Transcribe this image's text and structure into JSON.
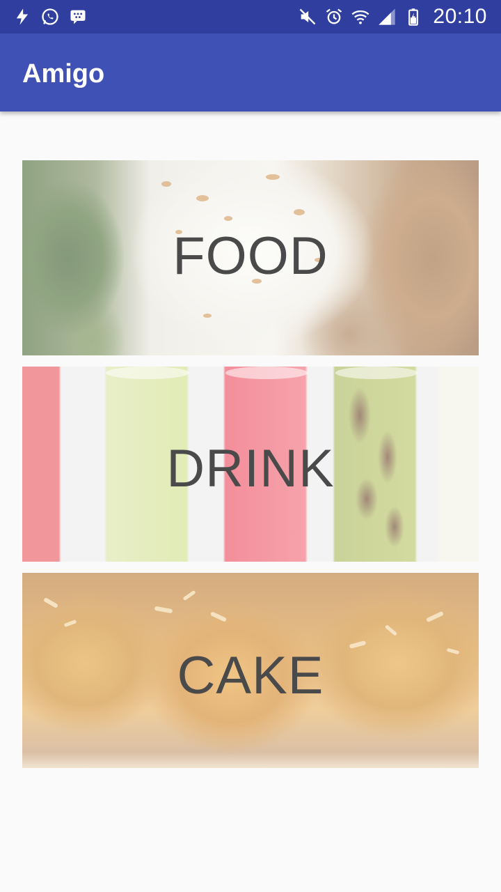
{
  "status_bar": {
    "time": "20:10",
    "left_icons": [
      "flash-icon",
      "whatsapp-icon",
      "bbm-icon"
    ],
    "right_icons": [
      "mute-icon",
      "alarm-icon",
      "wifi-icon",
      "signal-icon",
      "battery-icon"
    ]
  },
  "app_bar": {
    "title": "Amigo",
    "color": "#3f51b5",
    "status_color": "#303f9f"
  },
  "categories": [
    {
      "label": "FOOD",
      "image": "food-photo"
    },
    {
      "label": "DRINK",
      "image": "drink-photo"
    },
    {
      "label": "CAKE",
      "image": "cake-photo"
    }
  ]
}
